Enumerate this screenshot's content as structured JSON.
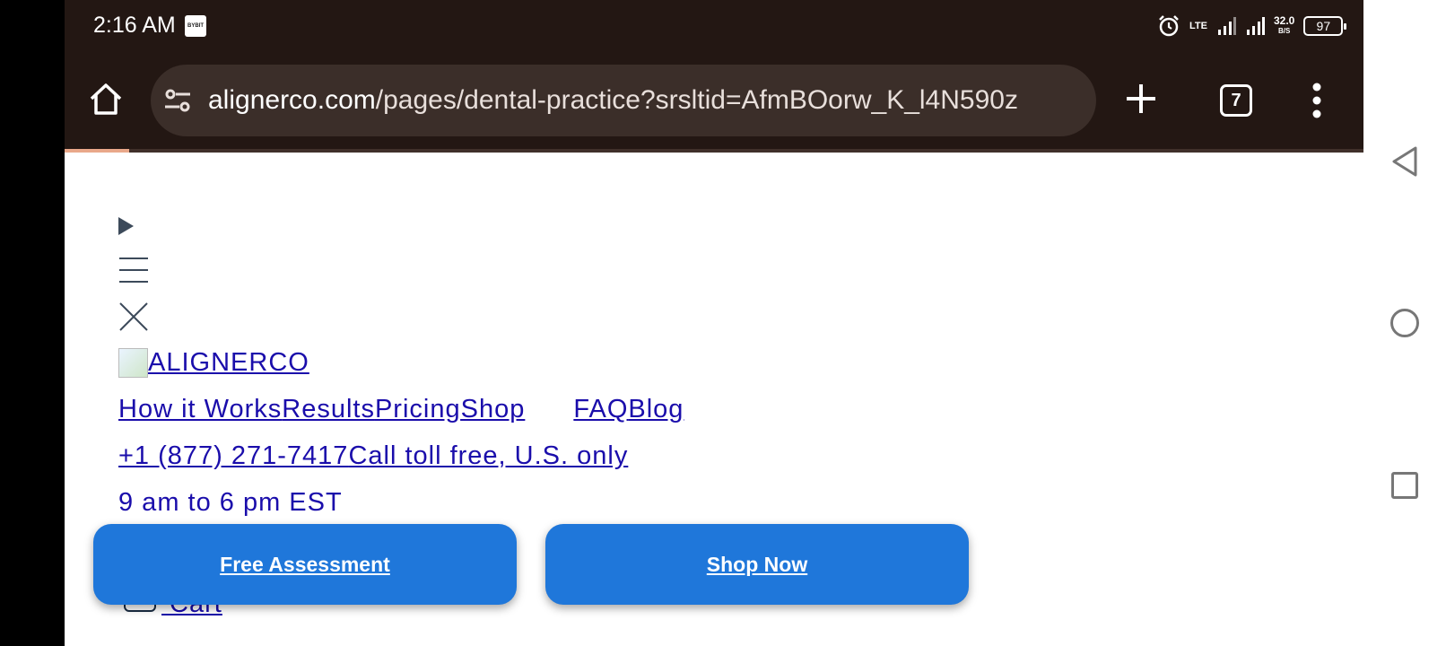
{
  "status_bar": {
    "time": "2:16 AM",
    "app_badge": "BYBIT",
    "network": "LTE",
    "speed": "32.0",
    "speed_unit": "B/S",
    "battery": "97"
  },
  "toolbar": {
    "url_host": "alignerco.com",
    "url_path": "/pages/dental-practice?srsltid=AfmBOorw_K_l4N590z",
    "tab_count": "7",
    "load_progress": 0.05
  },
  "page": {
    "logo_alt": "ALIGNERCO",
    "nav": [
      "How it Works",
      "Results",
      "Pricing",
      "Shop",
      "FAQ",
      "Blog"
    ],
    "phone": "+1 (877) 271-7417",
    "phone_note": "Call toll free, U.S. only",
    "hours": "9 am to 6 pm EST",
    "cart_label": " Cart"
  },
  "cta": {
    "free_assessment": "Free Assessment",
    "shop_now": "Shop Now"
  },
  "icons": {
    "home": "home-icon",
    "site_settings": "tune-icon",
    "new_tab": "plus-icon",
    "menu": "more-vert-icon",
    "disclosure": "triangle-right-icon",
    "hamburger": "hamburger-icon",
    "close": "close-x-icon",
    "cart": "cart-icon",
    "alarm": "alarm-icon",
    "nav_back": "back-icon",
    "nav_home": "circle-home-icon",
    "nav_recents": "square-recents-icon"
  },
  "colors": {
    "toolbar_bg": "#231713",
    "url_bar_bg": "#3b2e29",
    "link": "#1a0dab",
    "cta_bg": "#1f77da"
  }
}
